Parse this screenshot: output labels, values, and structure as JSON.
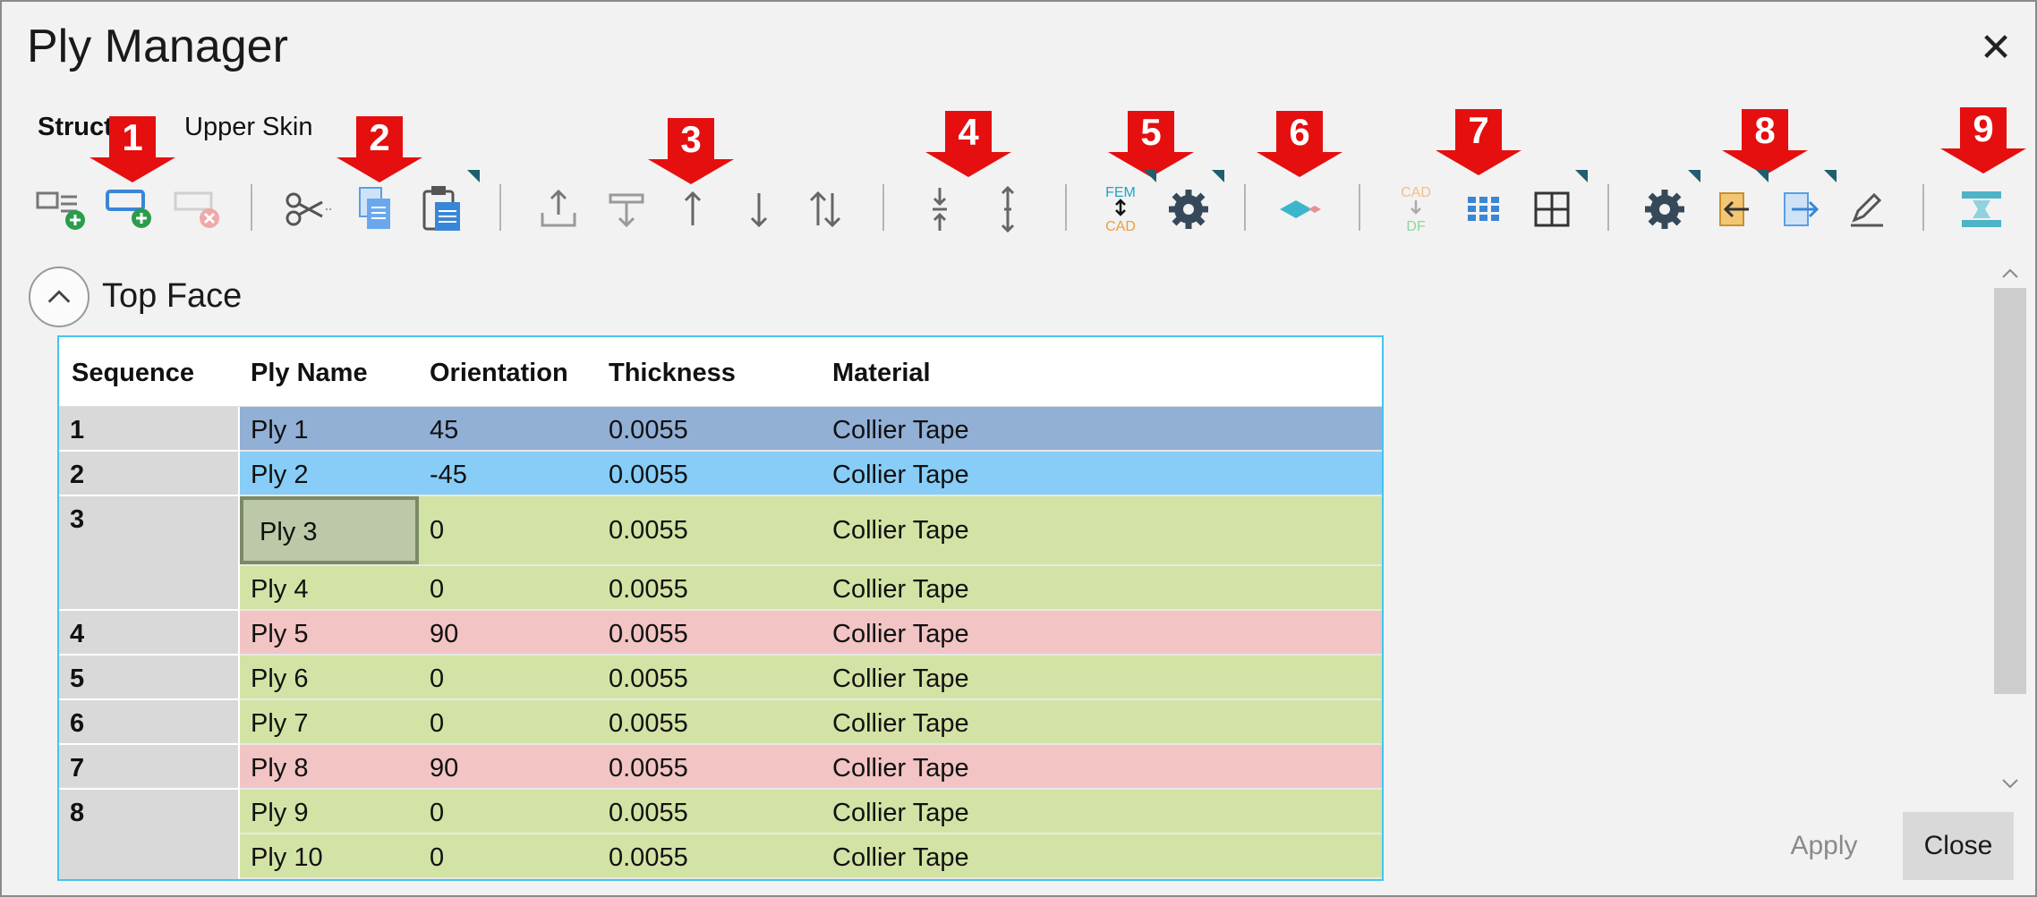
{
  "window": {
    "title": "Ply Manager",
    "close_glyph": "✕"
  },
  "breadcrumb": {
    "structure": "Struct",
    "component": "Upper Skin"
  },
  "callouts": [
    "1",
    "2",
    "3",
    "4",
    "5",
    "6",
    "7",
    "8",
    "9"
  ],
  "toolbar": {
    "icons": [
      "add-ply-icon",
      "add-plies-icon",
      "remove-ply-icon",
      "cut-icon",
      "copy-icon",
      "paste-icon",
      "move-to-top-icon",
      "move-to-bottom-icon",
      "move-up-icon",
      "move-down-icon",
      "swap-icon",
      "compress-icon",
      "expand-icon",
      "fem-cad-sync-icon",
      "settings-gear-icon",
      "layer-shape-icon",
      "cad-to-df-icon",
      "grid-view-icon",
      "table-view-icon",
      "options-gear-icon",
      "import-icon",
      "export-icon",
      "edit-pencil-icon",
      "stack-icon"
    ],
    "fem_label": "FEM",
    "cad_label": "CAD",
    "cad2_label": "CAD",
    "df_label": "DF"
  },
  "section": {
    "title": "Top Face"
  },
  "table": {
    "columns": [
      "Sequence",
      "Ply Name",
      "Orientation",
      "Thickness",
      "Material"
    ],
    "sequences": [
      "1",
      "2",
      "3",
      "4",
      "5",
      "6",
      "7",
      "8"
    ],
    "rows": [
      {
        "name": "Ply 1",
        "orientation": "45",
        "thickness": "0.0055",
        "material": "Collier Tape"
      },
      {
        "name": "Ply 2",
        "orientation": "-45",
        "thickness": "0.0055",
        "material": "Collier Tape"
      },
      {
        "name": "Ply 3",
        "orientation": "0",
        "thickness": "0.0055",
        "material": "Collier Tape"
      },
      {
        "name": "Ply 4",
        "orientation": "0",
        "thickness": "0.0055",
        "material": "Collier Tape"
      },
      {
        "name": "Ply 5",
        "orientation": "90",
        "thickness": "0.0055",
        "material": "Collier Tape"
      },
      {
        "name": "Ply 6",
        "orientation": "0",
        "thickness": "0.0055",
        "material": "Collier Tape"
      },
      {
        "name": "Ply 7",
        "orientation": "0",
        "thickness": "0.0055",
        "material": "Collier Tape"
      },
      {
        "name": "Ply 8",
        "orientation": "90",
        "thickness": "0.0055",
        "material": "Collier Tape"
      },
      {
        "name": "Ply 9",
        "orientation": "0",
        "thickness": "0.0055",
        "material": "Collier Tape"
      },
      {
        "name": "Ply 10",
        "orientation": "0",
        "thickness": "0.0055",
        "material": "Collier Tape"
      }
    ]
  },
  "colors": {
    "row_45": "#92b0d6",
    "row_neg45": "#87cdf7",
    "row_0": "#d3e3a5",
    "row_90": "#f2c4c4",
    "selected_cell": "#bcc8a7",
    "accent_border": "#43c5f0",
    "callout_red": "#e50f0f"
  },
  "footer": {
    "apply_label": "Apply",
    "close_label": "Close"
  }
}
